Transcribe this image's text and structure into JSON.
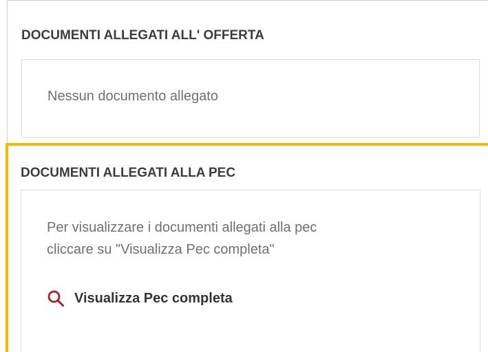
{
  "offerta": {
    "title": "DOCUMENTI ALLEGATI ALL' OFFERTA",
    "empty_message": "Nessun documento allegato"
  },
  "pec": {
    "title": "DOCUMENTI ALLEGATI ALLA PEC",
    "instructions_line1": "Per visualizzare i documenti allegati alla pec",
    "instructions_line2": "cliccare su \"Visualizza Pec completa\"",
    "link_label": "Visualizza Pec completa",
    "link_icon": "search-icon"
  },
  "colors": {
    "highlight_border": "#f5b800",
    "icon": "#a3212b",
    "title_text": "#3c3c3c",
    "body_text": "#6f6f6f"
  }
}
